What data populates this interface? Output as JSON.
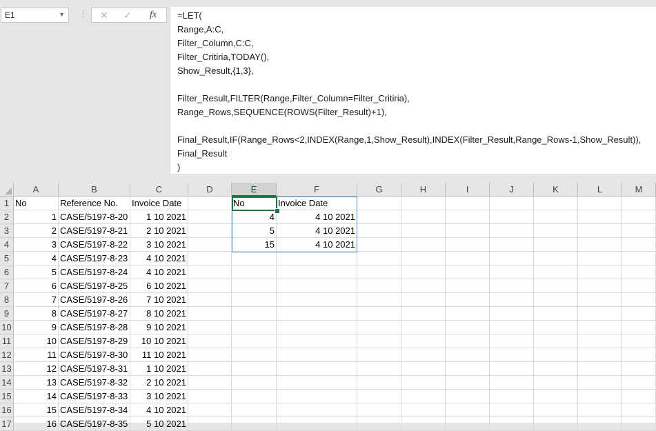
{
  "name_box": "E1",
  "formula_bar": {
    "cancel_icon": "✕",
    "enter_icon": "✓",
    "fx_label": "fx",
    "lines": [
      "=LET(",
      "Range,A:C,",
      "Filter_Column,C:C,",
      "Filter_Critiria,TODAY(),",
      "Show_Result,{1,3},",
      "",
      "Filter_Result,FILTER(Range,Filter_Column=Filter_Critiria),",
      "Range_Rows,SEQUENCE(ROWS(Filter_Result)+1),",
      "",
      "Final_Result,IF(Range_Rows<2,INDEX(Range,1,Show_Result),INDEX(Filter_Result,Range_Rows-1,Show_Result)),",
      "Final_Result",
      ")"
    ]
  },
  "columns": [
    "A",
    "B",
    "C",
    "D",
    "E",
    "F",
    "G",
    "H",
    "I",
    "J",
    "K",
    "L",
    "M"
  ],
  "selected_column": "E",
  "rows": [
    {
      "n": "1",
      "A": "No",
      "B": "Reference No.",
      "C": "Invoice Date",
      "E": "No",
      "F": "Invoice Date"
    },
    {
      "n": "2",
      "A": "1",
      "B": "CASE/5197-8-20",
      "C": "1 10 2021",
      "E": "4",
      "F": "4 10 2021"
    },
    {
      "n": "3",
      "A": "2",
      "B": "CASE/5197-8-21",
      "C": "2 10 2021",
      "E": "5",
      "F": "4 10 2021"
    },
    {
      "n": "4",
      "A": "3",
      "B": "CASE/5197-8-22",
      "C": "3 10 2021",
      "E": "15",
      "F": "4 10 2021"
    },
    {
      "n": "5",
      "A": "4",
      "B": "CASE/5197-8-23",
      "C": "4 10 2021"
    },
    {
      "n": "6",
      "A": "5",
      "B": "CASE/5197-8-24",
      "C": "4 10 2021"
    },
    {
      "n": "7",
      "A": "6",
      "B": "CASE/5197-8-25",
      "C": "6 10 2021"
    },
    {
      "n": "8",
      "A": "7",
      "B": "CASE/5197-8-26",
      "C": "7 10 2021"
    },
    {
      "n": "9",
      "A": "8",
      "B": "CASE/5197-8-27",
      "C": "8 10 2021"
    },
    {
      "n": "10",
      "A": "9",
      "B": "CASE/5197-8-28",
      "C": "9 10 2021"
    },
    {
      "n": "11",
      "A": "10",
      "B": "CASE/5197-8-29",
      "C": "10 10 2021"
    },
    {
      "n": "12",
      "A": "11",
      "B": "CASE/5197-8-30",
      "C": "11 10 2021"
    },
    {
      "n": "13",
      "A": "12",
      "B": "CASE/5197-8-31",
      "C": "1 10 2021"
    },
    {
      "n": "14",
      "A": "13",
      "B": "CASE/5197-8-32",
      "C": "2 10 2021"
    },
    {
      "n": "15",
      "A": "14",
      "B": "CASE/5197-8-33",
      "C": "3 10 2021"
    },
    {
      "n": "16",
      "A": "15",
      "B": "CASE/5197-8-34",
      "C": "4 10 2021"
    },
    {
      "n": "17",
      "A": "16",
      "B": "CASE/5197-8-35",
      "C": "5 10 2021"
    }
  ],
  "colors": {
    "accent": "#217346",
    "spill_border": "#5b8ccf"
  }
}
